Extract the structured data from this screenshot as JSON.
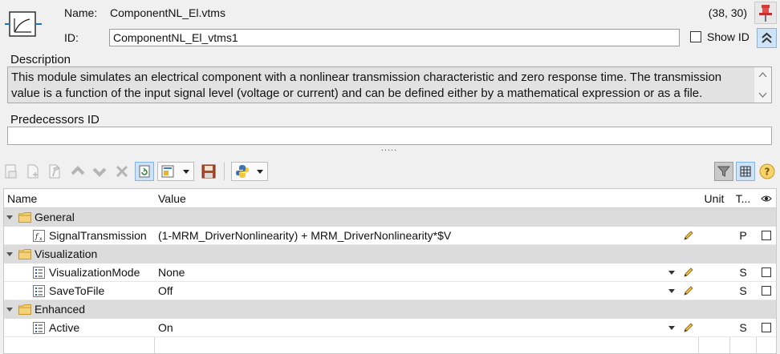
{
  "header": {
    "name_label": "Name:",
    "name_value": "ComponentNL_El.vtms",
    "coords": "(38, 30)",
    "id_label": "ID:",
    "id_value": "ComponentNL_El_vtms1",
    "show_id_label": "Show ID",
    "show_id_checked": false,
    "pin_icon": "pushpin-icon",
    "collapse_icon": "double-chevron-up-icon",
    "module_icon": "transfer-curve-icon"
  },
  "description": {
    "label": "Description",
    "text": "This module simulates an electrical component with a nonlinear transmission characteristic and zero response time. The transmission value is a function of the input signal level (voltage or current) and can be defined either by a mathematical expression or as a file."
  },
  "predecessors": {
    "label": "Predecessors ID",
    "value": ""
  },
  "splitter": {
    "grip": "....."
  },
  "toolbar": {
    "left_buttons": [
      "new-item-icon",
      "new-child-icon",
      "properties-icon",
      "move-up-icon",
      "move-down-icon",
      "delete-icon",
      "refresh-icon",
      "template-icon",
      "save-icon",
      "python-icon"
    ],
    "right_buttons": [
      "filter-icon",
      "grid-icon",
      "help-icon"
    ]
  },
  "table": {
    "columns": {
      "name": "Name",
      "value": "Value",
      "unit": "Unit",
      "type": "T...",
      "visible_icon": "eye-icon"
    },
    "groups": [
      {
        "label": "General",
        "params": [
          {
            "name": "SignalTransmission",
            "icon": "function-icon",
            "value": "(1-MRM_DriverNonlinearity) + MRM_DriverNonlinearity*$V",
            "has_dropdown": false,
            "unit": "",
            "type": "P"
          }
        ]
      },
      {
        "label": "Visualization",
        "params": [
          {
            "name": "VisualizationMode",
            "icon": "list-icon",
            "value": "None",
            "has_dropdown": true,
            "unit": "",
            "type": "S"
          },
          {
            "name": "SaveToFile",
            "icon": "list-icon",
            "value": "Off",
            "has_dropdown": true,
            "unit": "",
            "type": "S"
          }
        ]
      },
      {
        "label": "Enhanced",
        "params": [
          {
            "name": "Active",
            "icon": "list-icon",
            "value": "On",
            "has_dropdown": true,
            "unit": "",
            "type": "S"
          }
        ]
      }
    ]
  }
}
